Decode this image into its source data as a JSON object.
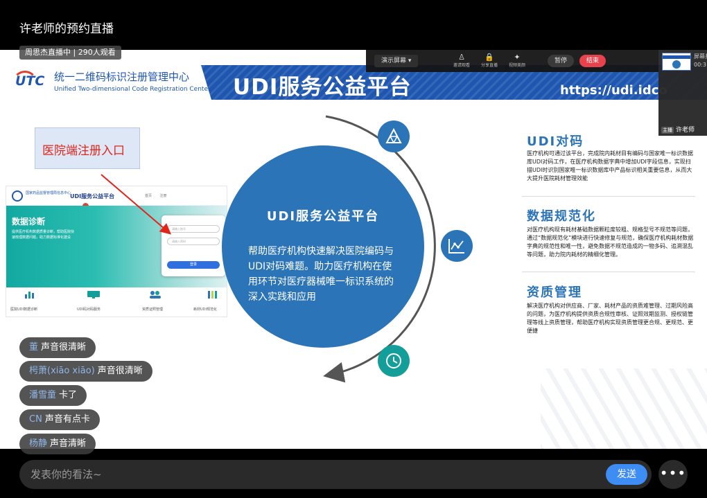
{
  "header": {
    "title": "许老师的预约直播",
    "live_badge": "周思杰直播中 | 290人观看"
  },
  "controls": {
    "share_label": "演示屏幕 ▾",
    "items": [
      {
        "icon": "user-icon",
        "label": "邀请观看"
      },
      {
        "icon": "lock-icon",
        "label": "分享直播"
      },
      {
        "icon": "sparkle-icon",
        "label": "视频美颜"
      }
    ],
    "pause_label": "暂停",
    "end_label": "结束"
  },
  "side_panel": {
    "name": "屏幕共",
    "time": "00:3",
    "host_tag": "主播",
    "host_name": "许老师"
  },
  "slide": {
    "logo_mark": "UTC",
    "org_cn": "统一二维码标识注册管理中心",
    "org_en": "Unified Two-dimensional Code Registration Center",
    "title": "UDI服务公益平台",
    "url": "https://udi.idco",
    "hospital_label": "医院端注册入口",
    "thumb": {
      "org": "国家药品监督管理局信息中心",
      "site_name": "UDI服务公益平台",
      "nav": "首页 注册",
      "hero_title": "数据诊断",
      "hero_text": "提供医疗机构数据质量诊断，帮助医院快速梳理数据问题，助力数据标准化建设",
      "field1": "请输入账号",
      "field2": "请输入密码",
      "login_label": "登录",
      "icons": [
        {
          "label": "医院UDI数据诊断"
        },
        {
          "label": "UDI码对码服务"
        },
        {
          "label": "资质证照管理"
        },
        {
          "label": "耗材UDI规范化"
        }
      ]
    },
    "center_title": "UDI服务公益平台",
    "center_desc": "帮助医疗机构快速解决医院编码与UDI对码难题。助力医疗机构在使用环节对医疗器械唯一标识系统的深入实践和应用",
    "features": [
      {
        "title": "UDI对码",
        "desc": "医疗机构可通过该平台，完成院内耗材目有编码与国家唯一标识数据库UDI对码工作，在医疗机构数据字典中增加UDI字段信息，实现扫描UDI时识别国家唯一标识数据库中产品标识相关重要信息，从而大大提升医院耗材管理效能"
      },
      {
        "title": "数据规范化",
        "desc": "对医疗机构现有耗材基础数据颗粒度较粗、规格型号不规范等问题，通过“数据规范化”模块进行快速修复与规范，确保医疗机构耗材数据字典的规范性和唯一性，避免数据不规范造成的一物多码、追溯混乱等问题，助力院内耗材的精细化管理。"
      },
      {
        "title": "资质管理",
        "desc": "解决医疗机构对供应商、厂家、耗材产品的资质难管理、过期风险高的问题，为医疗机构提供资质合规性审核、证照效期监测、授权链管理等线上资质管理，帮助医疗机构实现资质管理更合规、更规范、更便捷"
      }
    ]
  },
  "comments": [
    {
      "user": "董",
      "msg": "声音很清晰"
    },
    {
      "user": "枵萧(xiāo xiāo)",
      "msg": "声音很清晰"
    },
    {
      "user": "潘雪童",
      "msg": "卡了"
    },
    {
      "user": "CN",
      "msg": "声音有点卡"
    },
    {
      "user": "杨静",
      "msg": "声音清晰"
    }
  ],
  "footer": {
    "placeholder": "发表你的看法~",
    "send_label": "发送",
    "more_label": "•••"
  },
  "colors": {
    "brand_blue": "#1f57b0",
    "circle_blue": "#2c74b8",
    "teal": "#149e9a",
    "end_red": "#e8434d",
    "send_blue": "#3d8df5"
  }
}
